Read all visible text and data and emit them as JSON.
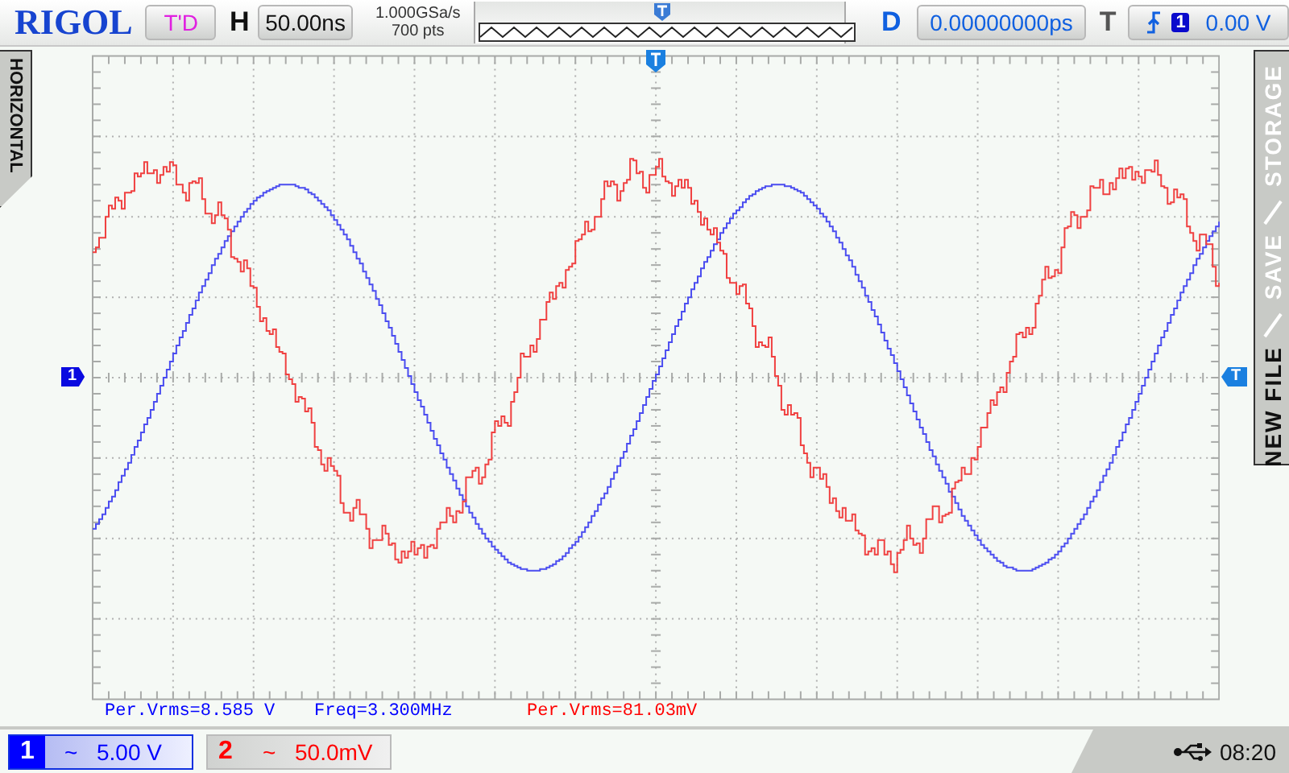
{
  "logo": "RIGOL",
  "status": {
    "run_state": "T'D",
    "horizontal_label": "H",
    "timebase": "50.00ns",
    "sample_rate": "1.000GSa/s",
    "memory_depth": "700 pts",
    "delay_label": "D",
    "delay": "0.00000000ps",
    "trigger_label": "T",
    "trigger_source": "1",
    "trigger_level": "0.00 V"
  },
  "left_menu": {
    "label": "HORIZONTAL"
  },
  "right_menu": {
    "items": [
      {
        "label": "STORAGE",
        "selected": false
      },
      {
        "label": "SAVE",
        "selected": false
      },
      {
        "label": "NEW FILE",
        "selected": true
      }
    ]
  },
  "markers": {
    "channel": "1",
    "trigger": "T"
  },
  "measurements": [
    {
      "text": "Per.Vrms=8.585 V",
      "color": "#0000ff"
    },
    {
      "text": "Freq=3.300MHz",
      "color": "#0000ff"
    },
    {
      "text": "Per.Vrms=81.03mV",
      "color": "#ff0000"
    }
  ],
  "channels": [
    {
      "number": "1",
      "coupling": "~",
      "scale": "5.00 V",
      "selected": true,
      "color": "#0000ff"
    },
    {
      "number": "2",
      "coupling": "~",
      "scale": "50.0mV",
      "selected": false,
      "color": "#ff0000"
    }
  ],
  "clock": "08:20"
}
